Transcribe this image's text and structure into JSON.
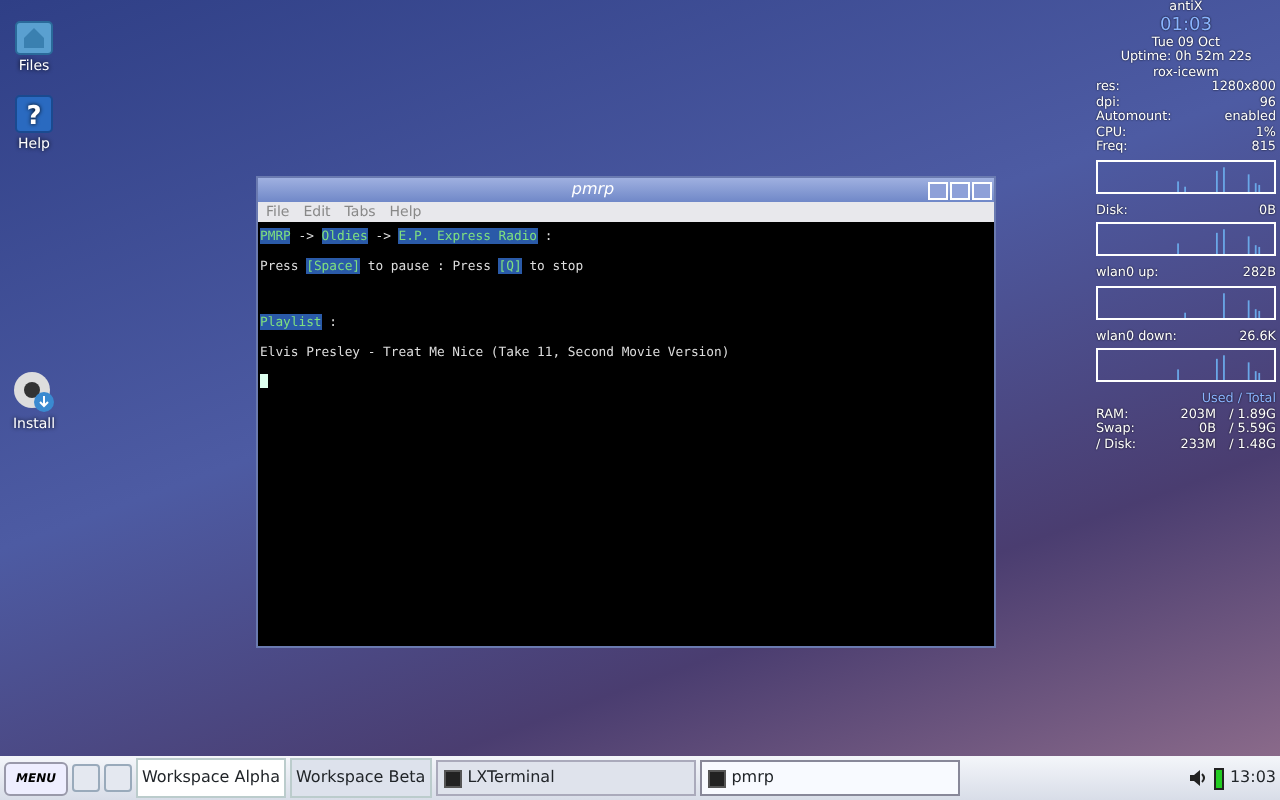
{
  "desktop_icons": [
    {
      "kind": "folder",
      "label": "Files"
    },
    {
      "kind": "help",
      "glyph": "?",
      "label": "Help"
    },
    {
      "kind": "install",
      "label": "Install"
    }
  ],
  "window": {
    "title": "pmrp",
    "menu": [
      "File",
      "Edit",
      "Tabs",
      "Help"
    ],
    "lines": [
      {
        "segments": [
          {
            "text": "PMRP",
            "highlighted": true
          },
          {
            "text": " -> ",
            "highlighted": false
          },
          {
            "text": "Oldies",
            "highlighted": true
          },
          {
            "text": " -> ",
            "highlighted": false
          },
          {
            "text": "E.P. Express Radio",
            "highlighted": true
          },
          {
            "text": " :",
            "highlighted": false
          }
        ]
      },
      {
        "segments": [
          {
            "text": "Press ",
            "highlighted": false
          },
          {
            "text": "[Space]",
            "highlighted": true
          },
          {
            "text": " to pause : Press ",
            "highlighted": false
          },
          {
            "text": "[Q]",
            "highlighted": true
          },
          {
            "text": " to stop",
            "highlighted": false
          }
        ]
      },
      {
        "segments": [
          {
            "text": "Playlist",
            "highlighted": true
          },
          {
            "text": " :",
            "highlighted": false
          }
        ]
      },
      {
        "segments": [
          {
            "text": "Elvis Presley - Treat Me Nice (Take 11, Second Movie Version)",
            "highlighted": false
          }
        ]
      }
    ]
  },
  "conky": {
    "host": "antiX",
    "time": "01:03",
    "date": "Tue 09 Oct",
    "uptime": "Uptime: 0h 52m 22s",
    "session": "rox-icewm",
    "stats": [
      {
        "label": "res:",
        "value": "1280x800"
      },
      {
        "label": "dpi:",
        "value": "96"
      },
      {
        "label": "Automount:",
        "value": "enabled"
      },
      {
        "label": "CPU:",
        "value": "1%"
      },
      {
        "label": "Freq:",
        "value": "815"
      }
    ],
    "graphs": [
      {
        "label": "Disk:",
        "value": "0B"
      },
      {
        "label": "wlan0 up:",
        "value": "282B"
      },
      {
        "label": "wlan0 down:",
        "value": "26.6K"
      }
    ],
    "memory_header": "Used / Total",
    "memory": [
      {
        "label": "RAM:",
        "used": "203M",
        "total": "/ 1.89G"
      },
      {
        "label": "Swap:",
        "used": "0B",
        "total": "/ 5.59G"
      },
      {
        "label": "/ Disk:",
        "used": "233M",
        "total": "/ 1.48G"
      }
    ]
  },
  "taskbar": {
    "menu": "MENU",
    "workspaces": [
      {
        "label": "Workspace Alpha",
        "selected": true
      },
      {
        "label": "Workspace Beta",
        "selected": false
      }
    ],
    "tasks": [
      {
        "label": "LXTerminal",
        "selected": false
      },
      {
        "label": "pmrp",
        "selected": true
      }
    ],
    "clock": "13:03"
  }
}
